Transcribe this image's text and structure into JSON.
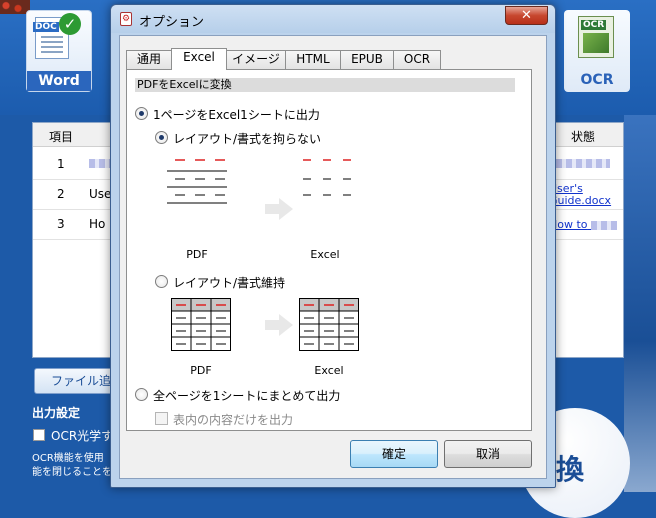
{
  "background": {
    "tiles": {
      "word_label": "Word",
      "word_icon_tag": "DOC",
      "ocr_label": "OCR",
      "ocr_icon_tag": "OCR"
    },
    "table": {
      "header_col1": "項目",
      "header_status": "状態",
      "rows": [
        {
          "num": "1",
          "name": ""
        },
        {
          "num": "2",
          "name": "Use"
        },
        {
          "num": "3",
          "name": "Ho"
        }
      ],
      "status_links": [
        "p",
        "User's Guide.docx",
        "How to"
      ]
    },
    "add_button": "ファイル追加",
    "output_settings": "出力設定",
    "ocr_checkbox_label": "OCR光学す",
    "ocr_note_line1": "OCR機能を使用",
    "ocr_note_line2": "能を閉じることをお",
    "convert_button": "換"
  },
  "dialog": {
    "title": "オプション",
    "close_glyph": "✕",
    "tabs": [
      "通用",
      "Excel",
      "イメージ",
      "HTML",
      "EPUB",
      "OCR"
    ],
    "active_tab": "Excel",
    "section_header": "PDFをExcelに変換",
    "option_one_sheet_per_page": "1ページをExcel1シートに出力",
    "option_no_layout": "レイアウト/書式を拘らない",
    "option_keep_layout": "レイアウト/書式維持",
    "option_all_pages_one_sheet": "全ページを1シートにまとめて出力",
    "option_table_only": "表内の内容だけを出力",
    "caption_pdf": "PDF",
    "caption_excel": "Excel",
    "ok_button": "確定",
    "cancel_button": "取消"
  }
}
